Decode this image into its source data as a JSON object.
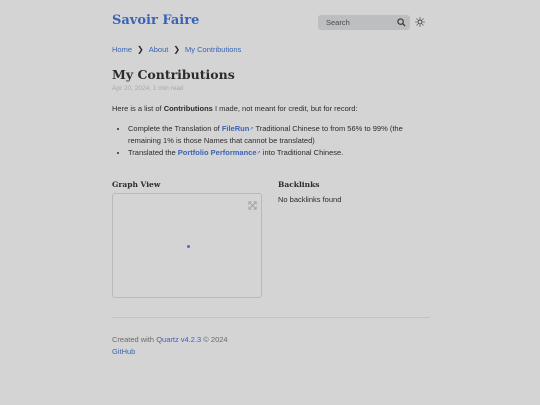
{
  "header": {
    "site_title": "Savoir Faire",
    "search_placeholder": "Search"
  },
  "breadcrumb": {
    "items": [
      "Home",
      "About",
      "My Contributions"
    ],
    "separator": "❯"
  },
  "article": {
    "title": "My Contributions",
    "meta": "Apr 20, 2024, 1 min read",
    "intro_before": "Here is a list of ",
    "intro_bold": "Contributions",
    "intro_after": " I made, not meant for credit, but for record:",
    "items": [
      {
        "before": "Complete the Translation of ",
        "link": "FileRun",
        "after": " Traditional Chinese to from 56% to 99% (the remaining 1% is those Names that cannot be translated)"
      },
      {
        "before": "Translated the ",
        "link": "Portfolio Performance",
        "after": " into Traditional Chinese."
      }
    ]
  },
  "graph": {
    "title": "Graph View"
  },
  "backlinks": {
    "title": "Backlinks",
    "empty": "No backlinks found"
  },
  "footer": {
    "created_with": "Created with ",
    "quartz_link": "Quartz v4.2.3",
    "year": " © 2024",
    "github": "GitHub"
  },
  "colors": {
    "background": "#d4d4d5",
    "accent": "#3a63b5",
    "text": "#2b2b2b"
  },
  "icons": [
    "search-icon",
    "sun-icon",
    "external-link-icon",
    "expand-icon"
  ]
}
